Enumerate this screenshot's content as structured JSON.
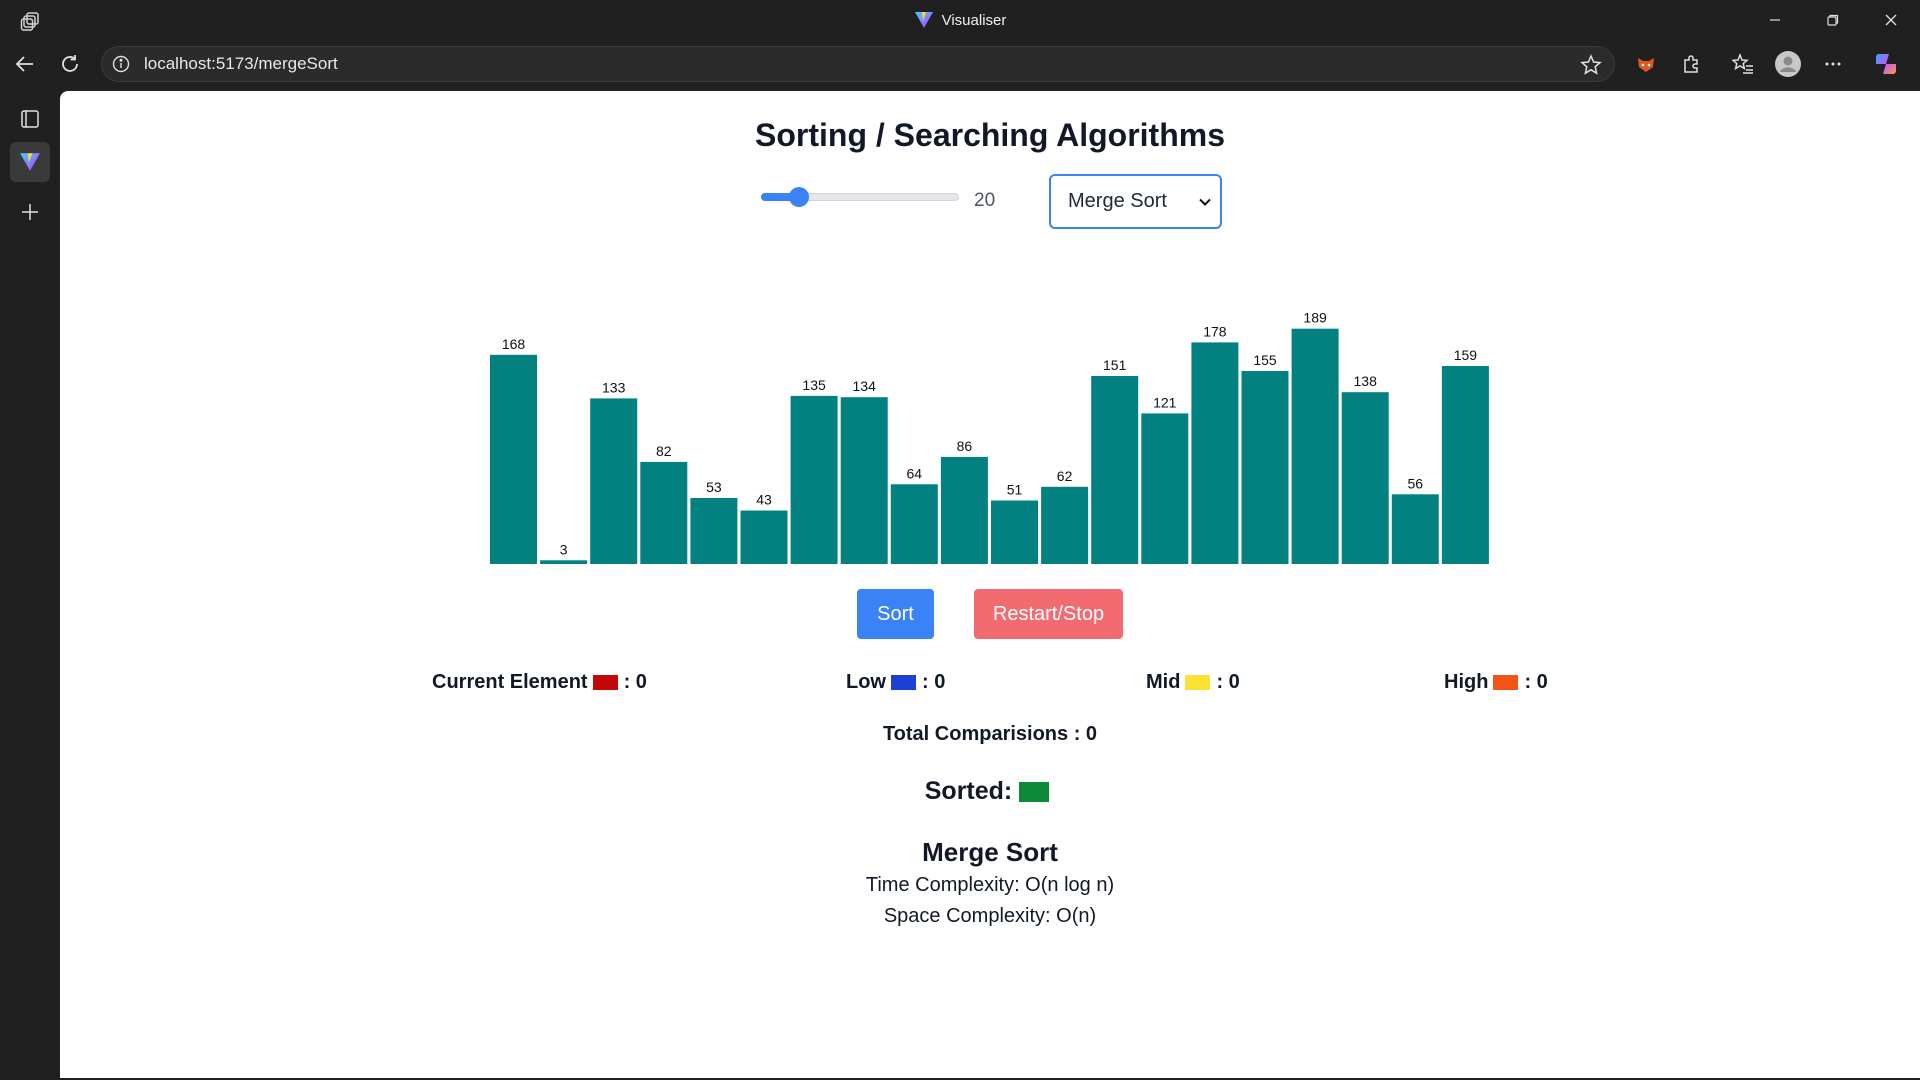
{
  "browser": {
    "window_title": "Visualiser",
    "url": "localhost:5173/mergeSort"
  },
  "page": {
    "title": "Sorting / Searching Algorithms",
    "array_size": 20,
    "array_size_fraction": 0.19,
    "algorithm_selected": "Merge Sort",
    "sort_button": "Sort",
    "restart_button": "Restart/Stop",
    "legend": {
      "current": {
        "label": "Current Element",
        "value": ": 0",
        "color": "#c40808"
      },
      "low": {
        "label": "Low",
        "value": ": 0",
        "color": "#1d3fd6"
      },
      "mid": {
        "label": "Mid",
        "value": ": 0",
        "color": "#fde132"
      },
      "high": {
        "label": "High",
        "value": ": 0",
        "color": "#f25415"
      }
    },
    "total_comparisons": "Total Comparisions : 0",
    "sorted_label": "Sorted:",
    "sorted_color": "#0b8a3a",
    "algo_name": "Merge Sort",
    "time_complexity": "Time Complexity: O(n log n)",
    "space_complexity": "Space Complexity: O(n)",
    "bar_color": "#038080"
  },
  "chart_data": {
    "type": "bar",
    "values": [
      168,
      3,
      133,
      82,
      53,
      43,
      135,
      134,
      64,
      86,
      51,
      62,
      151,
      121,
      178,
      155,
      189,
      138,
      56,
      159
    ]
  }
}
